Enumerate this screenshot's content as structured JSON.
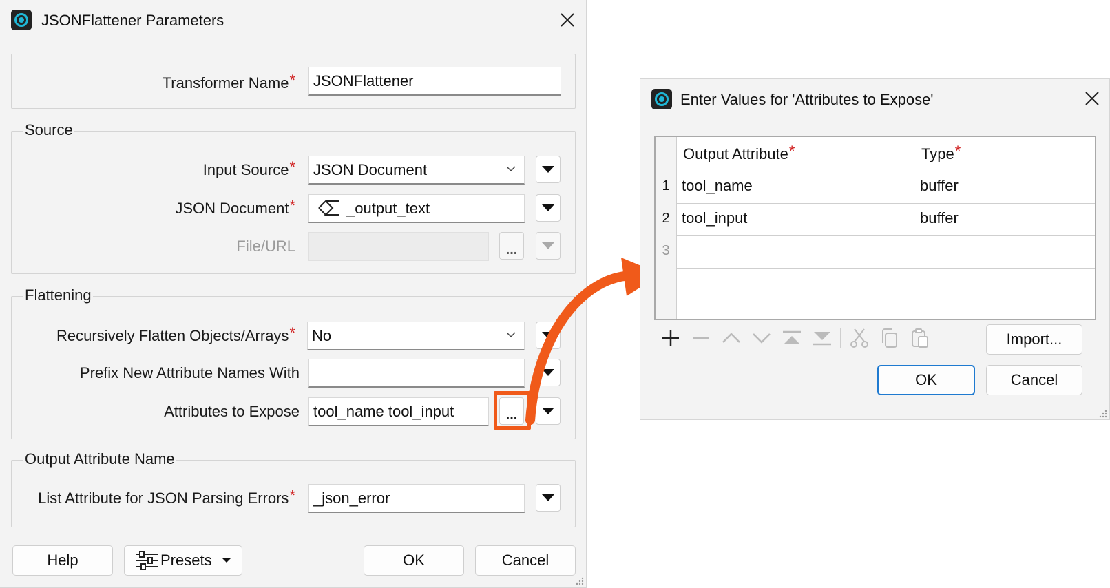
{
  "main_dialog": {
    "title": "JSONFlattener Parameters",
    "transformer_name": {
      "label": "Transformer Name",
      "required": "*",
      "value": "JSONFlattener"
    },
    "source": {
      "heading": "Source",
      "input_source": {
        "label": "Input Source",
        "required": "*",
        "value": "JSON Document"
      },
      "json_document": {
        "label": "JSON Document",
        "required": "*",
        "value": "_output_text"
      },
      "file_url": {
        "label": "File/URL",
        "value": "",
        "browse": "..."
      }
    },
    "flattening": {
      "heading": "Flattening",
      "recursively_flatten": {
        "label": "Recursively Flatten Objects/Arrays",
        "required": "*",
        "value": "No"
      },
      "prefix": {
        "label": "Prefix New Attribute Names With",
        "value": ""
      },
      "attributes_to_expose": {
        "label": "Attributes to Expose",
        "value": "tool_name tool_input",
        "browse": "..."
      }
    },
    "output_attribute_name": {
      "heading": "Output Attribute Name",
      "list_attribute": {
        "label": "List Attribute for JSON Parsing Errors",
        "required": "*",
        "value": "_json_error"
      }
    },
    "buttons": {
      "help": "Help",
      "presets": "Presets",
      "ok": "OK",
      "cancel": "Cancel"
    }
  },
  "values_dialog": {
    "title": "Enter Values for 'Attributes to Expose'",
    "columns": [
      {
        "label": "Output Attribute",
        "required": "*"
      },
      {
        "label": "Type",
        "required": "*"
      }
    ],
    "rows": [
      {
        "num": "1",
        "attribute": "tool_name",
        "type": "buffer"
      },
      {
        "num": "2",
        "attribute": "tool_input",
        "type": "buffer"
      },
      {
        "num": "3",
        "attribute": "",
        "type": ""
      }
    ],
    "toolbar_icons": [
      "plus-icon",
      "minus-icon",
      "move-up-icon",
      "move-down-icon",
      "move-top-icon",
      "move-bottom-icon",
      "cut-icon",
      "copy-icon",
      "paste-icon"
    ],
    "buttons": {
      "import": "Import...",
      "ok": "OK",
      "cancel": "Cancel"
    }
  },
  "colors": {
    "accent": "#1f7ad0",
    "highlight": "#f05a1a",
    "required": "#d02020",
    "app_icon": "#1fb7d6"
  }
}
